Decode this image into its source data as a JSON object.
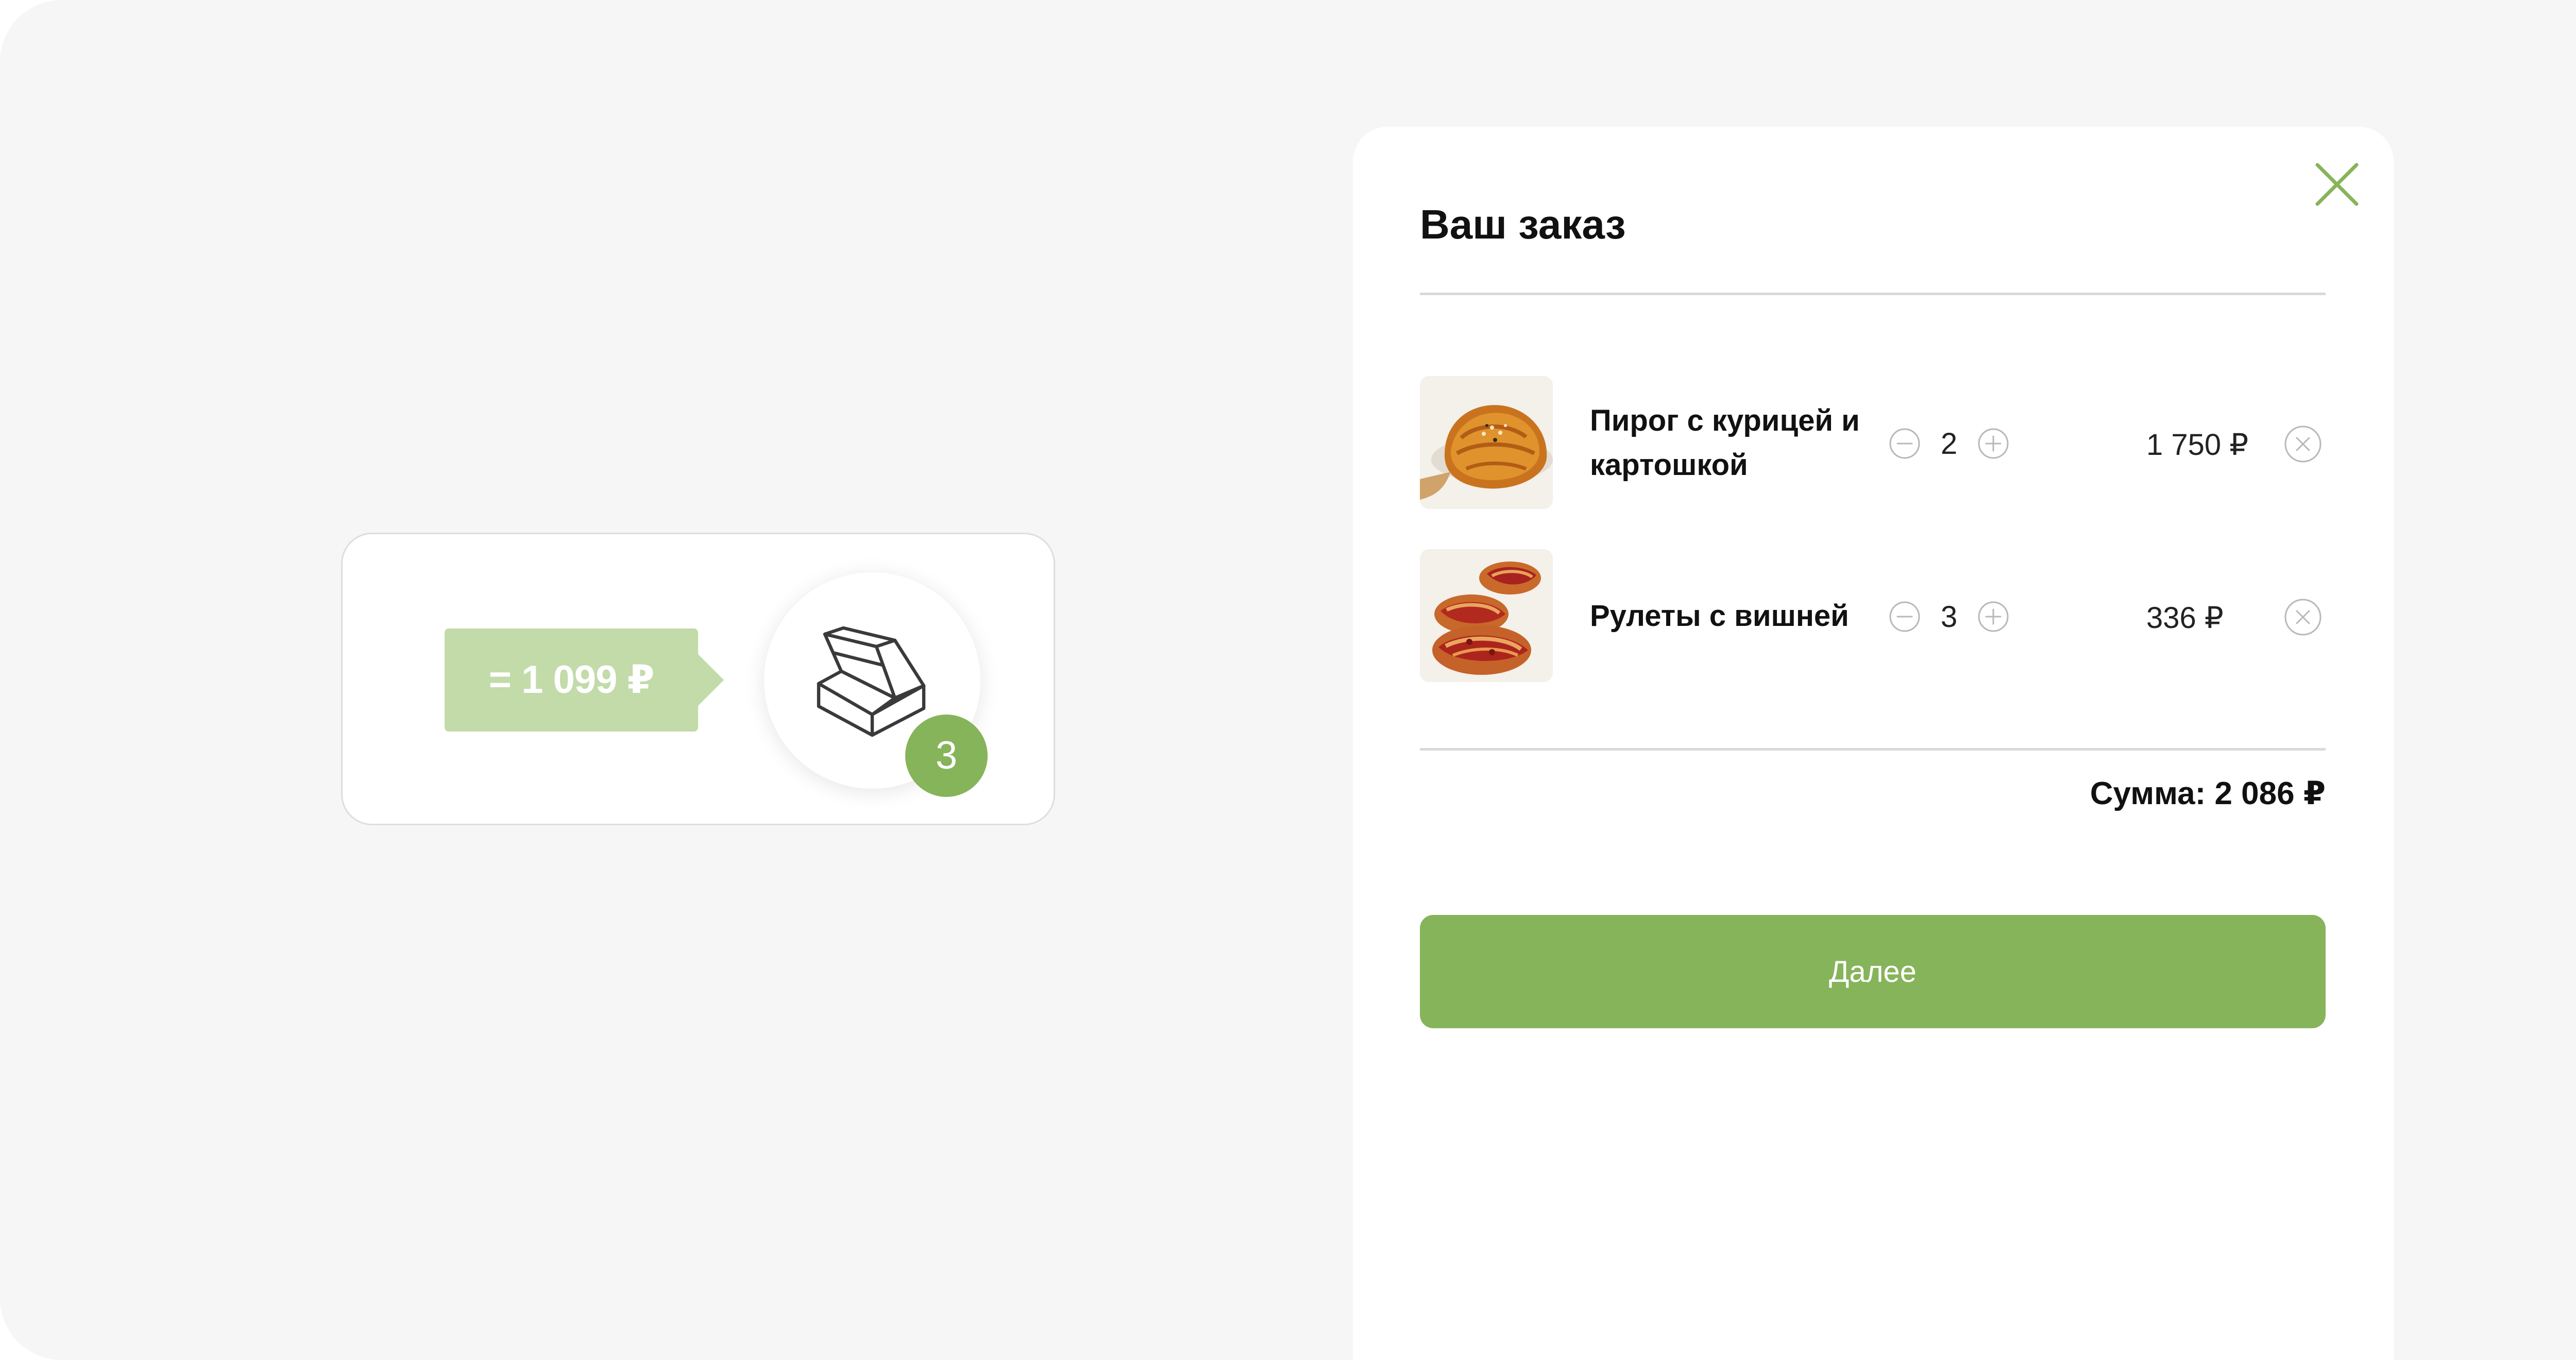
{
  "mini_cart": {
    "price_label": "= 1 099 ₽",
    "item_count": "3"
  },
  "order": {
    "title": "Ваш заказ",
    "items": [
      {
        "name": "Пирог с курицей и картошкой",
        "quantity": "2",
        "price": "1 750 ₽"
      },
      {
        "name": "Рулеты с вишней",
        "quantity": "3",
        "price": "336 ₽"
      }
    ],
    "sum_label": "Сумма: 2 086 ₽",
    "next_label": "Далее"
  },
  "colors": {
    "accent": "#86b45a",
    "accent_light": "#c2dba9",
    "background": "#f6f6f6",
    "panel": "#ffffff"
  },
  "icons": {
    "close": "close-icon",
    "box": "box-icon",
    "minus": "minus-circle-icon",
    "plus": "plus-circle-icon",
    "remove": "remove-circle-icon"
  }
}
